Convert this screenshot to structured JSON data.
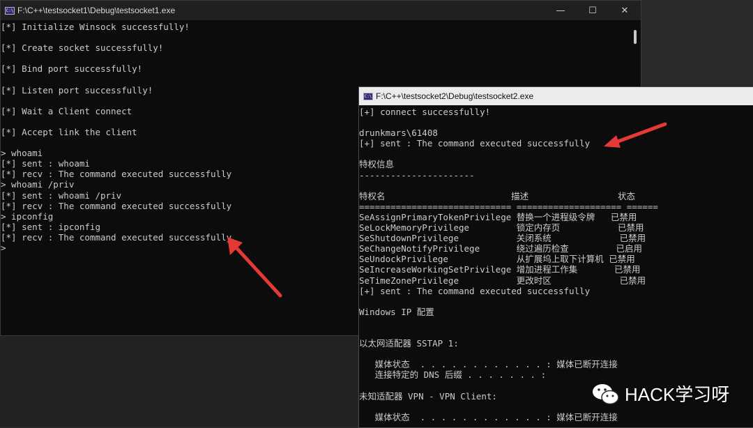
{
  "window1": {
    "title": "F:\\C++\\testsocket1\\Debug\\testsocket1.exe",
    "icon_label": "C:\\",
    "controls": {
      "minimize": "—",
      "maximize": "☐",
      "close": "✕"
    },
    "lines": [
      "[*] Initialize Winsock successfully!",
      "",
      "[*] Create socket successfully!",
      "",
      "[*] Bind port successfully!",
      "",
      "[*] Listen port successfully!",
      "",
      "[*] Wait a Client connect",
      "",
      "[*] Accept link the client",
      "",
      "> whoami",
      "[*] sent : whoami",
      "[*] recv : The command executed successfully",
      "> whoami /priv",
      "[*] sent : whoami /priv",
      "[*] recv : The command executed successfully",
      "> ipconfig",
      "[*] sent : ipconfig",
      "[*] recv : The command executed successfully",
      ">"
    ]
  },
  "window2": {
    "title": "F:\\C++\\testsocket2\\Debug\\testsocket2.exe",
    "icon_label": "C:\\",
    "lines": [
      "[+] connect successfully!",
      "",
      "drunkmars\\61408",
      "[+] sent : The command executed successfully",
      "",
      "特权信息",
      "----------------------",
      "",
      "特权名                        描述                 状态",
      "============================= ==================== ======",
      "SeAssignPrimaryTokenPrivilege 替换一个进程级令牌   已禁用",
      "SeLockMemoryPrivilege         锁定内存页           已禁用",
      "SeShutdownPrivilege           关闭系统             已禁用",
      "SeChangeNotifyPrivilege       绕过遍历检查         已启用",
      "SeUndockPrivilege             从扩展坞上取下计算机 已禁用",
      "SeIncreaseWorkingSetPrivilege 增加进程工作集       已禁用",
      "SeTimeZonePrivilege           更改时区             已禁用",
      "[+] sent : The command executed successfully",
      "",
      "Windows IP 配置",
      "",
      "",
      "以太网适配器 SSTAP 1:",
      "",
      "   媒体状态  . . . . . . . . . . . . : 媒体已断开连接",
      "   连接特定的 DNS 后缀 . . . . . . . :",
      "",
      "未知适配器 VPN - VPN Client:",
      "",
      "   媒体状态  . . . . . . . . . . . . : 媒体已断开连接"
    ]
  },
  "annotation": {
    "arrow_color": "#e53935"
  },
  "watermark": {
    "text": "HACK学习呀",
    "icon": "wechat-icon"
  }
}
